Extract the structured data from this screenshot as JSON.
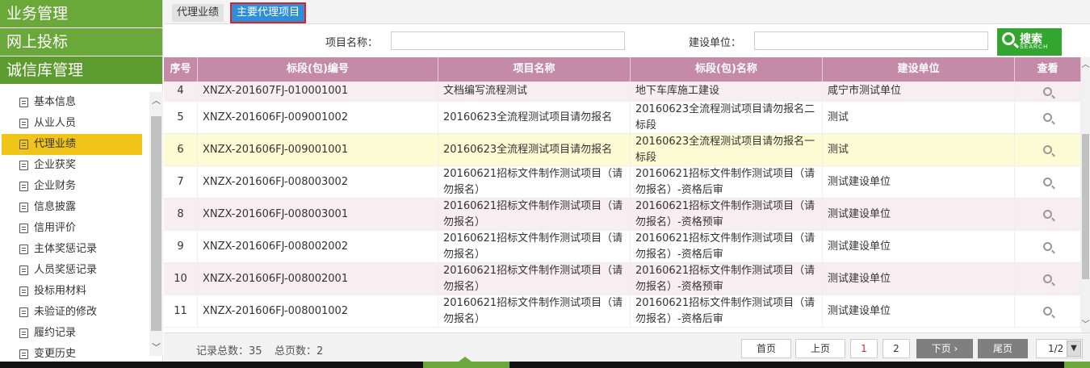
{
  "nav": {
    "sections": [
      "业务管理",
      "网上投标",
      "诚信库管理"
    ],
    "items": [
      "基本信息",
      "从业人员",
      "代理业绩",
      "企业获奖",
      "企业财务",
      "信息披露",
      "信用评价",
      "主体奖惩记录",
      "人员奖惩记录",
      "投标用材料",
      "未验证的修改",
      "履约记录",
      "变更历史"
    ],
    "selected_index": 2
  },
  "tabs": [
    "代理业绩",
    "主要代理项目"
  ],
  "filter": {
    "project_name_label": "项目名称：",
    "project_name_value": "",
    "builder_label": "建设单位：",
    "builder_value": "",
    "search_label": "搜索",
    "search_sub": "SEARCH"
  },
  "table": {
    "headers": [
      "序号",
      "标段(包)编号",
      "项目名称",
      "标段(包)名称",
      "建设单位",
      "查看"
    ],
    "rows": [
      {
        "no": "4",
        "code": "XNZX-201607FJ-010001001",
        "project": "文档编写流程测试",
        "section": "地下车库施工建设",
        "builder": "咸宁市测试单位"
      },
      {
        "no": "5",
        "code": "XNZX-201606FJ-009001002",
        "project": "20160623全流程测试项目请勿报名",
        "section": "20160623全流程测试项目请勿报名二标段",
        "builder": "测试"
      },
      {
        "no": "6",
        "code": "XNZX-201606FJ-009001001",
        "project": "20160623全流程测试项目请勿报名",
        "section": "20160623全流程测试项目请勿报名一标段",
        "builder": "测试"
      },
      {
        "no": "7",
        "code": "XNZX-201606FJ-008003002",
        "project": "20160621招标文件制作测试项目（请勿报名）",
        "section": "20160621招标文件制作测试项目（请勿报名）-资格后审",
        "builder": "测试建设单位"
      },
      {
        "no": "8",
        "code": "XNZX-201606FJ-008003001",
        "project": "20160621招标文件制作测试项目（请勿报名）",
        "section": "20160621招标文件制作测试项目（请勿报名）-资格预审",
        "builder": "测试建设单位"
      },
      {
        "no": "9",
        "code": "XNZX-201606FJ-008002002",
        "project": "20160621招标文件制作测试项目（请勿报名）",
        "section": "20160621招标文件制作测试项目（请勿报名）-资格后审",
        "builder": "测试建设单位"
      },
      {
        "no": "10",
        "code": "XNZX-201606FJ-008002001",
        "project": "20160621招标文件制作测试项目（请勿报名）",
        "section": "20160621招标文件制作测试项目（请勿报名）-资格预审",
        "builder": "测试建设单位"
      },
      {
        "no": "11",
        "code": "XNZX-201606FJ-008001002",
        "project": "20160621招标文件制作测试项目（请勿报名）",
        "section": "20160621招标文件制作测试项目（请勿报名）-资格后审",
        "builder": "测试建设单位"
      }
    ]
  },
  "footer": {
    "total_records": "记录总数：35",
    "total_pages": "总页数：2",
    "first": "首页",
    "prev": "上页",
    "page1": "1",
    "page2": "2",
    "next": "下页 ›",
    "last": "尾页",
    "page_select": "1/2"
  },
  "colors": {
    "nav_green": "#6aa83a",
    "header_pink": "#c48aa8",
    "selected_yellow": "#f0c419",
    "tab_blue": "#2e8fd6"
  }
}
